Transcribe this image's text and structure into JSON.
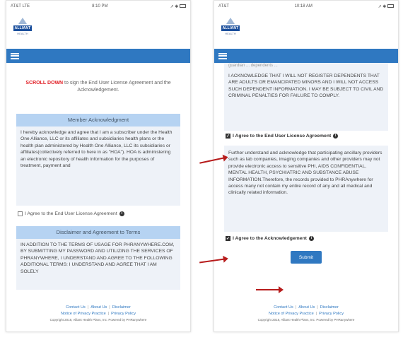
{
  "left": {
    "status": {
      "carrier": "AT&T LTE",
      "time": "8:10 PM",
      "right": "↗ ✱"
    },
    "logo": {
      "name": "ALLIANT",
      "sub": "HEALTH"
    },
    "intro": {
      "scroll_down": "SCROLL DOWN",
      "text": " to sign the End User License Agreement and the Acknowledgement."
    },
    "member_ack": {
      "title": "Member Acknowledgment",
      "body": "I hereby acknowledge and agree that I am a subscriber under the Health One Alliance, LLC or its affiliates and subsidiaries health plans or the health plan administered by Health One Alliance, LLC its subsidiaries or affiliates(collectively referred to here in as \"HOA\"). HOA is administering an electronic repository of health information for the purposes of treatment, payment and"
    },
    "agree_eula": "I Agree to the End User License Agreement",
    "disclaimer": {
      "title": "Disclaimer and Agreement to Terms",
      "body": "IN ADDITION TO THE TERMS OF USAGE FOR PHRANYWHERE.COM, BY SUBMITTING MY PASSWORD AND UTILIZING THE SERVICES OF PHRANYWHERE, I UNDERSTAND AND AGREE TO THE FOLLOWING ADDITIONAL TERMS: I UNDERSTAND AND AGREE THAT I AM SOLELY"
    }
  },
  "right": {
    "status": {
      "carrier": "AT&T",
      "time": "10:18 AM",
      "right": "↗ ✱"
    },
    "logo": {
      "name": "ALLIANT",
      "sub": "HEALTH"
    },
    "top_fragment": "guardian ... dependents ...",
    "ack_caps": "I ACKNOWLEDGE THAT I WILL NOT REGISTER DEPENDENTS THAT ARE ADULTS OR EMANCIPATED MINORS AND I WILL NOT ACCESS SUCH DEPENDENT INFORMATION. I MAY BE SUBJECT TO CIVIL AND CRIMINAL PENALTIES FOR FAILURE TO COMPLY.",
    "agree_eula": "I Agree to the End User License Agreement",
    "further": "Further understand and acknowledge that participating ancillary providers such as lab companies, imaging companies and other providers may not provide electronic access to sensitive PHI, AIDS CONFIDENTIAL, MENTAL HEALTH, PSYCHIATRIC AND SUBSTANCE ABUSE INFORMATION.Therefore, the records provided to PHRAnywhere for access many not contain my entire record of any and all medical and clinically related information.",
    "agree_ack": "I Agree to the Acknowledgement",
    "submit": "Submit"
  },
  "footer": {
    "contact": "Contact Us",
    "about": "About Us",
    "disclaimer": "Disclaimer",
    "privacy_notice": "Notice of Privacy Practice",
    "privacy_policy": "Privacy Policy",
    "copyright": "Copyright 2018, Alliant Health Plans, Inc. Powered by PHRanywhere"
  },
  "colors": {
    "nav_blue": "#2f78c1",
    "accent_red": "#e11e25",
    "arrow_red": "#b71c1c",
    "header_light_blue": "#b6d3f2"
  }
}
